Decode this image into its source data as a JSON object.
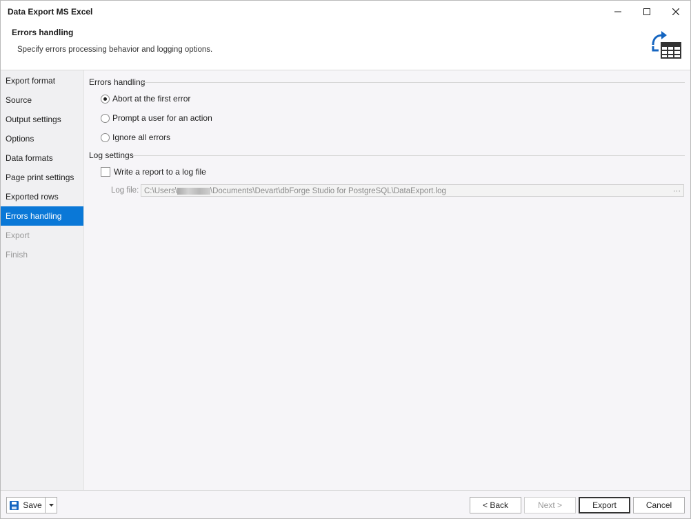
{
  "window": {
    "title": "Data Export MS Excel"
  },
  "header": {
    "title": "Errors handling",
    "description": "Specify errors processing behavior and logging options."
  },
  "sidebar": {
    "items": [
      {
        "label": "Export format",
        "state": "normal"
      },
      {
        "label": "Source",
        "state": "normal"
      },
      {
        "label": "Output settings",
        "state": "normal"
      },
      {
        "label": "Options",
        "state": "normal"
      },
      {
        "label": "Data formats",
        "state": "normal"
      },
      {
        "label": "Page print settings",
        "state": "normal"
      },
      {
        "label": "Exported rows",
        "state": "normal"
      },
      {
        "label": "Errors handling",
        "state": "active"
      },
      {
        "label": "Export",
        "state": "disabled"
      },
      {
        "label": "Finish",
        "state": "disabled"
      }
    ]
  },
  "errors_handling": {
    "group_label": "Errors handling",
    "options": [
      {
        "label": "Abort at the first error",
        "checked": true
      },
      {
        "label": "Prompt a user for an action",
        "checked": false
      },
      {
        "label": "Ignore all errors",
        "checked": false
      }
    ]
  },
  "log_settings": {
    "group_label": "Log settings",
    "write_report_label": "Write a report to a log file",
    "write_report_checked": false,
    "log_file_label": "Log file:",
    "log_file_path_prefix": "C:\\Users\\",
    "log_file_path_suffix": "\\Documents\\Devart\\dbForge Studio for PostgreSQL\\DataExport.log",
    "browse_label": "···"
  },
  "footer": {
    "save_label": "Save",
    "back_label": "< Back",
    "next_label": "Next >",
    "export_label": "Export",
    "cancel_label": "Cancel"
  },
  "colors": {
    "accent": "#0a78d7",
    "icon_blue": "#1565c0",
    "icon_dark": "#333333"
  }
}
